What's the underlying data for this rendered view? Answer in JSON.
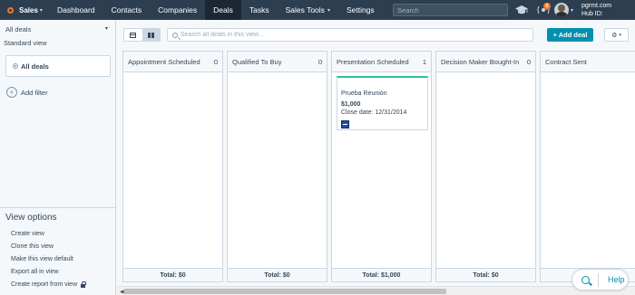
{
  "topnav": {
    "brand": "Sales",
    "items": [
      "Dashboard",
      "Contacts",
      "Companies",
      "Deals",
      "Tasks",
      "Sales Tools",
      "Settings"
    ],
    "active": "Deals",
    "search_placeholder": "Search",
    "notification_count": "5",
    "account_line1": "pgrmt.com",
    "account_line2": "Hub ID:"
  },
  "sidebar": {
    "view_select": "All deals",
    "view_type": "Standard view",
    "filter_label": "All deals",
    "add_filter": "Add filter",
    "options_title": "View options",
    "options": [
      "Create view",
      "Clone this view",
      "Make this view default",
      "Export all in view",
      "Create report from view"
    ]
  },
  "toolbar": {
    "search_placeholder": "Search all deals in this view...",
    "add_deal": "+ Add deal"
  },
  "board": {
    "columns": [
      {
        "title": "Appointment Scheduled",
        "count": "0",
        "total": "Total: $0"
      },
      {
        "title": "Qualified To Buy",
        "count": "0",
        "total": "Total: $0"
      },
      {
        "title": "Presentation Scheduled",
        "count": "1",
        "total": "Total: $1,000"
      },
      {
        "title": "Decision Maker Bought-In",
        "count": "0",
        "total": "Total: $0"
      },
      {
        "title": "Contract Sent",
        "count": "",
        "total": "Total: $0"
      }
    ],
    "deal": {
      "name": "Prueba Reunión",
      "amount": "$1,000",
      "close_date": "Close date: 12/31/2014"
    }
  },
  "help": {
    "label": "Help"
  },
  "colors": {
    "nav_bg": "#2d3e50",
    "accent": "#0091ae",
    "brand": "#f57722"
  }
}
